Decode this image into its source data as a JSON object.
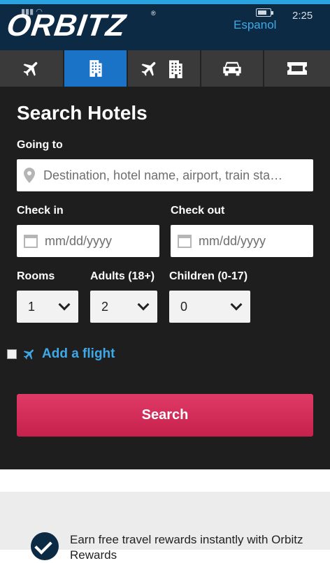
{
  "header": {
    "logo_text": "ORBITZ",
    "logo_reg": "®",
    "language_link": "Espanol",
    "clock": "2:25"
  },
  "tabs": [
    {
      "name": "flights",
      "icon": "plane-icon",
      "active": false
    },
    {
      "name": "hotels",
      "icon": "hotel-building-icon",
      "active": true
    },
    {
      "name": "flight-hotel",
      "icon": "plane-hotel-icon",
      "active": false
    },
    {
      "name": "cars",
      "icon": "car-icon",
      "active": false
    },
    {
      "name": "activities",
      "icon": "ticket-icon",
      "active": false
    }
  ],
  "search": {
    "title": "Search Hotels",
    "going_to_label": "Going to",
    "destination_placeholder": "Destination, hotel name, airport, train sta…",
    "checkin_label": "Check in",
    "checkin_placeholder": "mm/dd/yyyy",
    "checkout_label": "Check out",
    "checkout_placeholder": "mm/dd/yyyy",
    "rooms_label": "Rooms",
    "rooms_value": "1",
    "adults_label": "Adults (18+)",
    "adults_value": "2",
    "children_label": "Children (0-17)",
    "children_value": "0",
    "add_flight_label": "Add a flight",
    "search_button": "Search"
  },
  "rewards": {
    "text": "Earn free travel rewards instantly with Orbitz Rewards"
  },
  "colors": {
    "header_bg": "#0c2a44",
    "accent_blue": "#3fa9e8",
    "active_tab": "#1a73c6",
    "search_button": "#d42e5a"
  }
}
